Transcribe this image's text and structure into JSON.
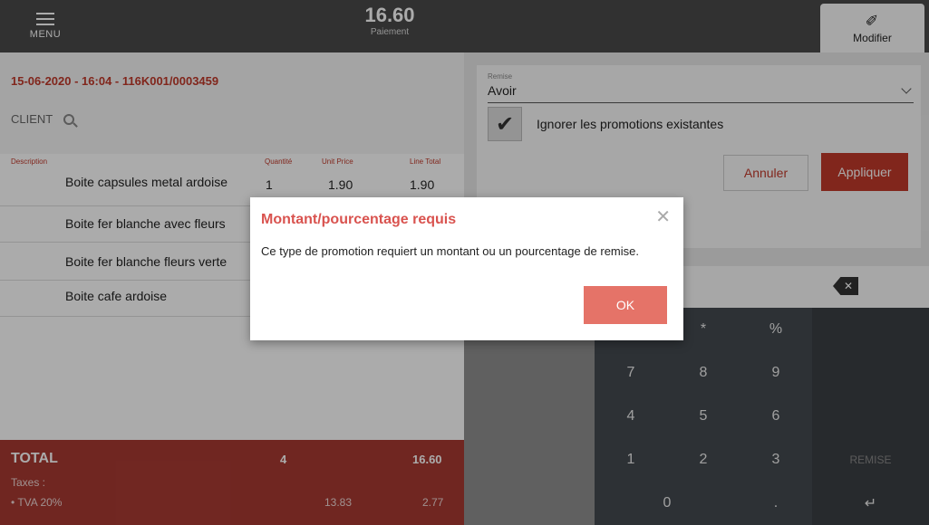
{
  "topbar": {
    "menu_label": "MENU",
    "total": "16.60",
    "total_sub": "Paiement",
    "modifier_label": "Modifier"
  },
  "ticket": {
    "id": "15-06-2020 - 16:04 - 116K001/0003459",
    "client_label": "CLIENT"
  },
  "table": {
    "headers": [
      "Description",
      "Quantité",
      "Unit Price",
      "Line Total"
    ],
    "rows": [
      {
        "desc": "Boite capsules metal ardoise",
        "qty": "1",
        "unit": "1.90",
        "total": "1.90"
      },
      {
        "desc": "Boite fer blanche avec fleurs",
        "qty": "",
        "unit": "",
        "total": ""
      },
      {
        "desc": "Boite fer blanche fleurs verte",
        "qty": "",
        "unit": "",
        "total": ""
      },
      {
        "desc": "Boite cafe ardoise",
        "qty": "",
        "unit": "",
        "total": ""
      }
    ]
  },
  "totals": {
    "label": "TOTAL",
    "qty": "4",
    "amount": "16.60",
    "taxes_label": "Taxes :",
    "tva_label": "• TVA 20%",
    "tva_base": "13.83",
    "tva_amount": "2.77"
  },
  "remise": {
    "caption": "Remise",
    "value": "Avoir",
    "ignore_label": "Ignorer les promotions existantes",
    "cancel": "Annuler",
    "apply": "Appliquer"
  },
  "keypad": {
    "star": "*",
    "percent": "%",
    "k7": "7",
    "k8": "8",
    "k9": "9",
    "k4": "4",
    "k5": "5",
    "k6": "6",
    "k1": "1",
    "k2": "2",
    "k3": "3",
    "k0": "0",
    "dot": ".",
    "remise": "REMISE",
    "enter": "↵"
  },
  "dialog": {
    "title": "Montant/pourcentage requis",
    "message": "Ce type de promotion requiert un montant ou un pourcentage de remise.",
    "ok": "OK",
    "close": "✕"
  },
  "colors": {
    "accent": "#c0392b",
    "dialog_title": "#d9534f",
    "ok_button": "#e57368",
    "total_bar": "#a83a32"
  }
}
